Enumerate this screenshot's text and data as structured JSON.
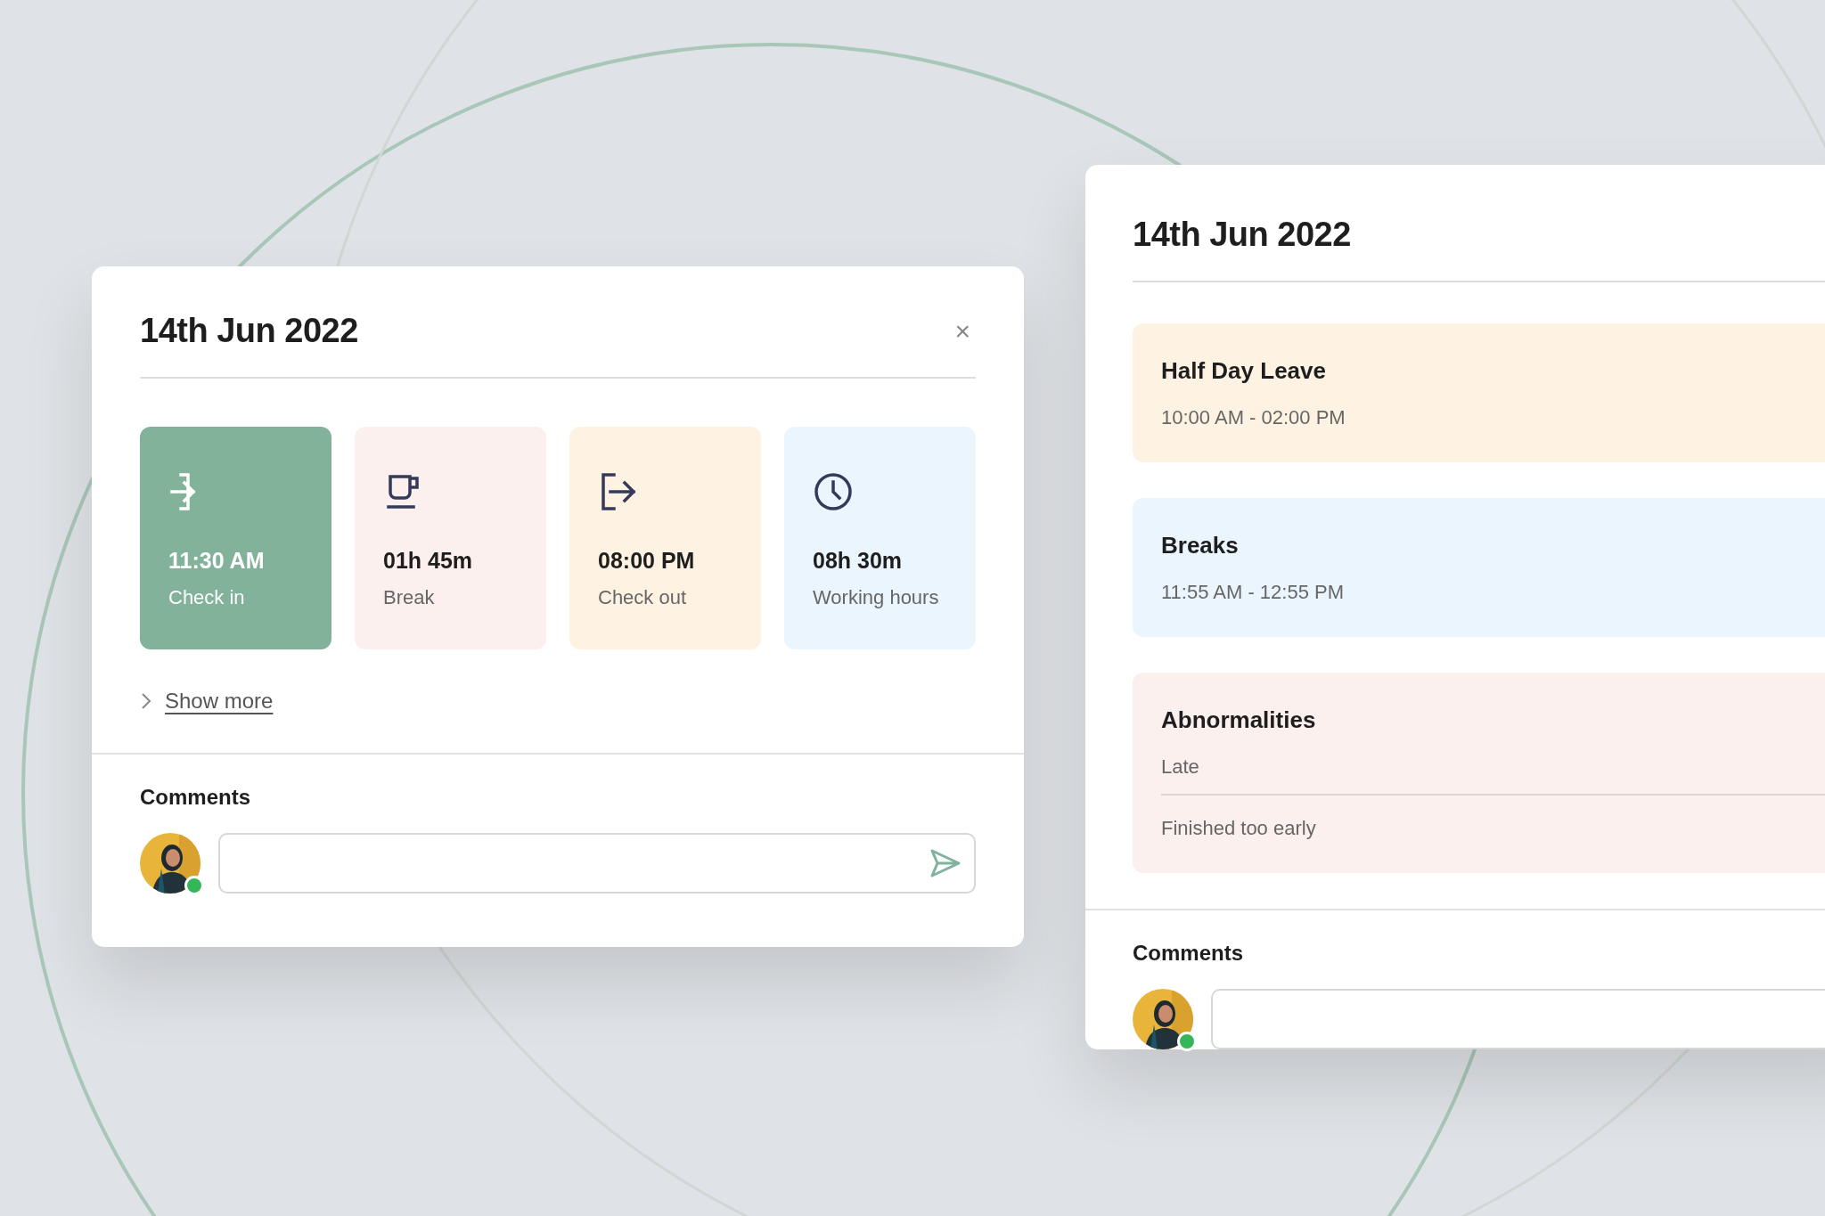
{
  "day_card": {
    "title": "14th Jun 2022",
    "close": "×",
    "stats": [
      {
        "kind": "checkin",
        "value": "11:30 AM",
        "label": "Check in",
        "color": "#82b29a"
      },
      {
        "kind": "coffee",
        "value": "01h 45m",
        "label": "Break",
        "color": "#fbf0ee"
      },
      {
        "kind": "checkout",
        "value": "08:00 PM",
        "label": "Check out",
        "color": "#fef3e2"
      },
      {
        "kind": "clock",
        "value": "08h 30m",
        "label": "Working hours",
        "color": "#ebf5fd"
      }
    ],
    "show_more": "Show more",
    "comments": {
      "heading": "Comments",
      "online": true
    }
  },
  "detail_card": {
    "title": "14th Jun 2022",
    "entries": [
      {
        "title": "Half Day Leave",
        "lines": [
          "10:00 AM - 02:00 PM"
        ],
        "color": "#fef3e2"
      },
      {
        "title": "Breaks",
        "lines": [
          "11:55 AM - 12:55 PM"
        ],
        "color": "#ebf5fd"
      },
      {
        "title": "Abnormalities",
        "lines": [
          "Late",
          "Finished too early"
        ],
        "color": "#fbf0ee"
      }
    ],
    "comments": {
      "heading": "Comments",
      "online": true
    }
  }
}
